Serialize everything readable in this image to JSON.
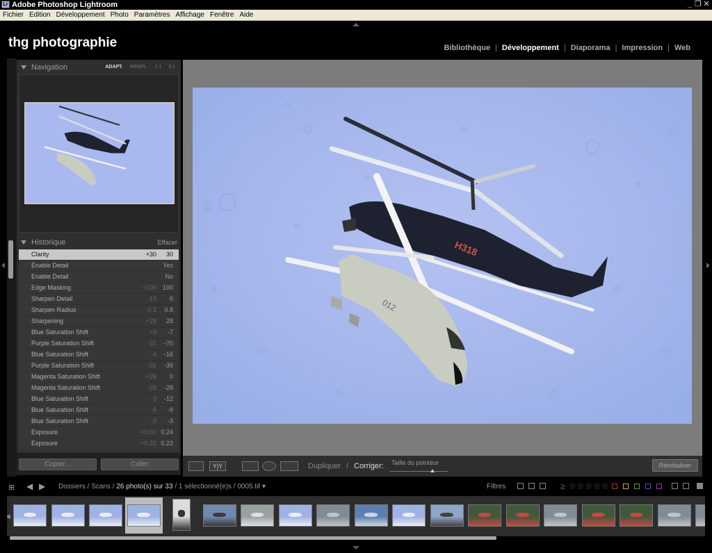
{
  "window": {
    "title": "Adobe Photoshop Lightroom",
    "app_icon": "Lr",
    "controls": [
      "_",
      "❐",
      "✕"
    ]
  },
  "menu": [
    "Fichier",
    "Edition",
    "Développement",
    "Photo",
    "Paramètres",
    "Affichage",
    "Fenêtre",
    "Aide"
  ],
  "identity": "thg photographie",
  "modules": [
    {
      "label": "Bibliothèque",
      "active": false
    },
    {
      "label": "Développement",
      "active": true
    },
    {
      "label": "Diaporama",
      "active": false
    },
    {
      "label": "Impression",
      "active": false
    },
    {
      "label": "Web",
      "active": false
    }
  ],
  "navigator": {
    "title": "Navigation",
    "zoom_options": [
      "ADAPT.",
      "REMPL.",
      "1:1",
      "3:1"
    ],
    "active_zoom": "ADAPT."
  },
  "history": {
    "title": "Historique",
    "clear_label": "Effacer",
    "items": [
      {
        "name": "Clarity",
        "delta": "+30",
        "value": "30",
        "selected": true
      },
      {
        "name": "Enable Detail",
        "delta": "",
        "value": "Yes"
      },
      {
        "name": "Enable Detail",
        "delta": "",
        "value": "No"
      },
      {
        "name": "Edge Masking",
        "delta": "+100",
        "value": "100"
      },
      {
        "name": "Sharpen Detail",
        "delta": "-19",
        "value": "6"
      },
      {
        "name": "Sharpen Radius",
        "delta": "-0.2",
        "value": "0.8"
      },
      {
        "name": "Sharpening",
        "delta": "+28",
        "value": "28"
      },
      {
        "name": "Blue Saturation Shift",
        "delta": "+9",
        "value": "-7"
      },
      {
        "name": "Purple Saturation Shift",
        "delta": "-31",
        "value": "-70"
      },
      {
        "name": "Blue Saturation Shift",
        "delta": "-4",
        "value": "-16"
      },
      {
        "name": "Purple Saturation Shift",
        "delta": "-31",
        "value": "-39"
      },
      {
        "name": "Magenta Saturation Shift",
        "delta": "+28",
        "value": "0"
      },
      {
        "name": "Magenta Saturation Shift",
        "delta": "-28",
        "value": "-28"
      },
      {
        "name": "Blue Saturation Shift",
        "delta": "-3",
        "value": "-12"
      },
      {
        "name": "Blue Saturation Shift",
        "delta": "-6",
        "value": "-9"
      },
      {
        "name": "Blue Saturation Shift",
        "delta": "-3",
        "value": "-3"
      },
      {
        "name": "Exposure",
        "delta": "+0.02",
        "value": "0.24"
      },
      {
        "name": "Exposure",
        "delta": "+0.22",
        "value": "0.22"
      }
    ]
  },
  "left_footer": {
    "copy_label": "Copier...",
    "paste_label": "Coller"
  },
  "toolbar": {
    "view_label": "Dupliquer",
    "separator": "/",
    "correct_label": "Corriger:",
    "brush_label": "Taille du pointeur",
    "brush_size": 0.6,
    "reset_label": "Réinitialiser"
  },
  "filmstrip_bar": {
    "path_prefix": "Dossiers / Scans /",
    "count": "26 photo(s) sur 33",
    "selection": " / 1 sélectionné(e)s / 0005.tif",
    "filters_label": "Filtres",
    "stars": "≥ ☆☆☆☆☆"
  },
  "filter_colors": [
    "#b83030",
    "#c8b030",
    "#4a9a40",
    "#3a5aa8",
    "#8a3aa8"
  ],
  "filmstrip": {
    "selected_index": 3,
    "thumbs": [
      "sky-plane",
      "sky-heli",
      "sky-jet",
      "sky-heli-pair",
      "portrait-pilot",
      "field-heli",
      "hangar-jet",
      "sky-jet2",
      "ground-heli",
      "runway",
      "sky-heli3",
      "tarmac-crew",
      "cockpit-green",
      "cockpit-red",
      "ground-heli2",
      "cockpit-gauge",
      "cockpit-dash",
      "ground-jet",
      "ground-jet2"
    ]
  }
}
